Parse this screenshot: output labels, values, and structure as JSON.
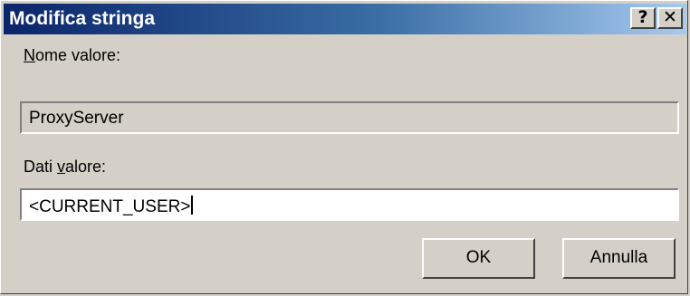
{
  "window": {
    "title": "Modifica stringa",
    "help_glyph": "?",
    "close_glyph": "✕"
  },
  "name_label": {
    "accel": "N",
    "rest": "ome valore:"
  },
  "name_value": "ProxyServer",
  "data_label": {
    "before": "Dati ",
    "accel": "v",
    "after": "alore:"
  },
  "data_value": "<CURRENT_USER>",
  "buttons": {
    "ok": "OK",
    "cancel": "Annulla"
  },
  "colors": {
    "face": "#d4d0c8",
    "title_start": "#0a246a",
    "title_end": "#a6caf0"
  }
}
